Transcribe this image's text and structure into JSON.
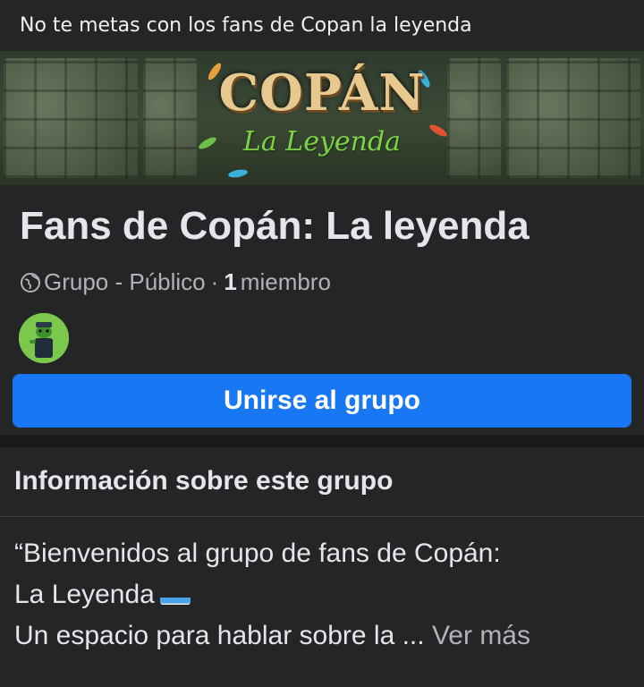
{
  "caption": "No te metas con los fans de Copan la leyenda",
  "cover": {
    "title": "COPÁN",
    "subtitle": "La Leyenda"
  },
  "group": {
    "name": "Fans de Copán: La leyenda",
    "type_privacy": "Grupo - Público",
    "separator": "·",
    "member_count": "1",
    "member_label": "miembro"
  },
  "join_button_label": "Unirse al grupo",
  "about": {
    "heading": "Información sobre este grupo",
    "line1": "“Bienvenidos al grupo de fans de Copán:",
    "line2": "La Leyenda",
    "line3": "Un espacio para hablar sobre la ...",
    "see_more": "Ver más"
  },
  "icons": {
    "privacy": "globe-icon",
    "emoji": "honduras-flag-icon"
  },
  "colors": {
    "background": "#242526",
    "primary_button": "#1877f2",
    "secondary_text": "#b0b3b8",
    "primary_text": "#e4e6eb"
  }
}
